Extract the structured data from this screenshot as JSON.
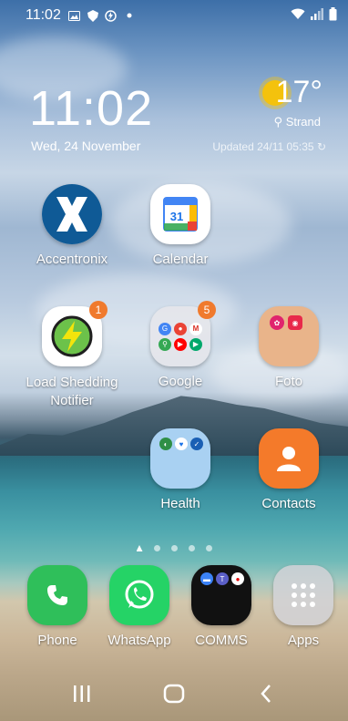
{
  "status": {
    "time": "11:02",
    "icons": [
      "image-icon",
      "shield-icon",
      "speed-icon",
      "dot-icon"
    ],
    "right_icons": [
      "wifi-icon",
      "signal-icon",
      "battery-icon"
    ]
  },
  "clock": {
    "time": "11:02",
    "date": "Wed, 24 November"
  },
  "weather": {
    "temp": "17°",
    "location": "Strand",
    "updated": "Updated 24/11 05:35",
    "sun_color": "#f4c20d"
  },
  "apps": [
    {
      "label": "Accentronix"
    },
    {
      "label": "Calendar",
      "icon_text": "31"
    },
    {
      "label": "Load Shedding Notifier",
      "badge": "1"
    },
    {
      "label": "Google",
      "badge": "5"
    },
    {
      "label": "Foto"
    },
    {
      "label": "Health"
    },
    {
      "label": "Contacts"
    }
  ],
  "dock": [
    {
      "label": "Phone"
    },
    {
      "label": "WhatsApp"
    },
    {
      "label": "COMMS"
    },
    {
      "label": "Apps"
    }
  ],
  "colors": {
    "badge": "#f07a2d",
    "phone": "#2fbf5a",
    "whatsapp": "#25d366",
    "contacts": "#f47a2a",
    "foto": "#e9b48a",
    "health": "#a9d1f2"
  }
}
